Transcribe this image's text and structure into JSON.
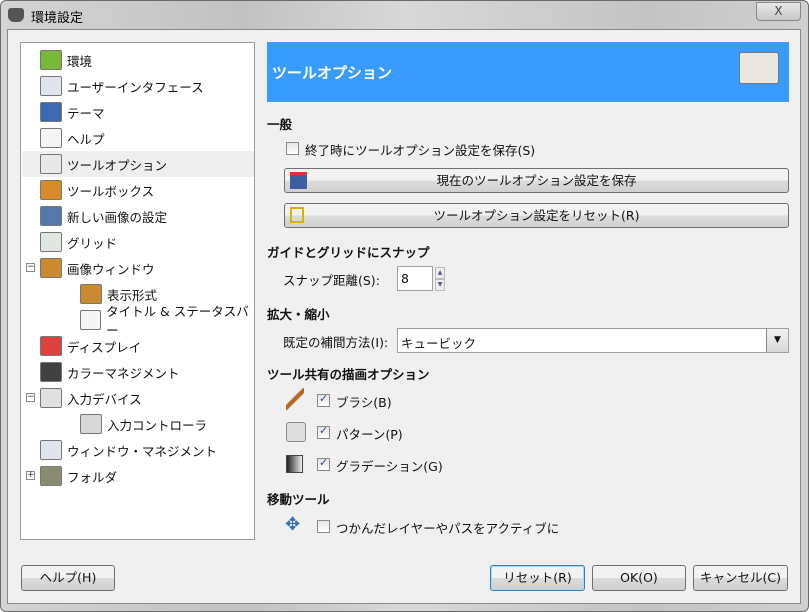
{
  "window": {
    "title": "環境設定",
    "close": "X"
  },
  "sidebar": {
    "items": [
      {
        "label": "環境",
        "icon": "environment-icon",
        "level": 0
      },
      {
        "label": "ユーザーインタフェース",
        "icon": "user-interface-icon",
        "level": 0
      },
      {
        "label": "テーマ",
        "icon": "theme-icon",
        "level": 0
      },
      {
        "label": "ヘルプ",
        "icon": "help-lifebuoy-icon",
        "level": 0
      },
      {
        "label": "ツールオプション",
        "icon": "tool-options-icon",
        "level": 0,
        "selected": true
      },
      {
        "label": "ツールボックス",
        "icon": "toolbox-icon",
        "level": 0
      },
      {
        "label": "新しい画像の設定",
        "icon": "new-image-icon",
        "level": 0
      },
      {
        "label": "グリッド",
        "icon": "grid-icon",
        "level": 0
      },
      {
        "label": "画像ウィンドウ",
        "icon": "image-window-icon",
        "level": 0,
        "expander": "−"
      },
      {
        "label": "表示形式",
        "icon": "appearance-icon",
        "level": 1
      },
      {
        "label": "タイトル & ステータスバー",
        "icon": "title-statusbar-icon",
        "level": 1
      },
      {
        "label": "ディスプレイ",
        "icon": "display-icon",
        "level": 0
      },
      {
        "label": "カラーマネジメント",
        "icon": "color-management-icon",
        "level": 0
      },
      {
        "label": "入力デバイス",
        "icon": "input-devices-icon",
        "level": 0,
        "expander": "−"
      },
      {
        "label": "入力コントローラ",
        "icon": "input-controllers-icon",
        "level": 1
      },
      {
        "label": "ウィンドウ・マネジメント",
        "icon": "window-management-icon",
        "level": 0
      },
      {
        "label": "フォルダ",
        "icon": "folders-icon",
        "level": 0,
        "expander": "+"
      }
    ]
  },
  "main": {
    "header": "ツールオプション",
    "general": {
      "title": "一般",
      "save_on_exit": "終了時にツールオプション設定を保存(S)",
      "save_on_exit_checked": false,
      "save_now": "現在のツールオプション設定を保存",
      "reset": "ツールオプション設定をリセット(R)"
    },
    "snap": {
      "title": "ガイドとグリッドにスナップ",
      "distance_label": "スナップ距離(S):",
      "distance_value": "8"
    },
    "scaling": {
      "title": "拡大・縮小",
      "interp_label": "既定の補間方法(I):",
      "interp_value": "キュービック"
    },
    "paint": {
      "title": "ツール共有の描画オプション",
      "brush": "ブラシ(B)",
      "pattern": "パターン(P)",
      "gradient": "グラデーション(G)",
      "brush_checked": true,
      "pattern_checked": true,
      "gradient_checked": true
    },
    "move": {
      "title": "移動ツール",
      "set_active": "つかんだレイヤーやパスをアクティブに",
      "set_active_checked": false
    }
  },
  "footer": {
    "help": "ヘルプ(H)",
    "reset": "リセット(R)",
    "ok": "OK(O)",
    "cancel": "キャンセル(C)"
  },
  "colors": {
    "header_bg": "#3a9bff",
    "selected_row": "#efefef"
  }
}
